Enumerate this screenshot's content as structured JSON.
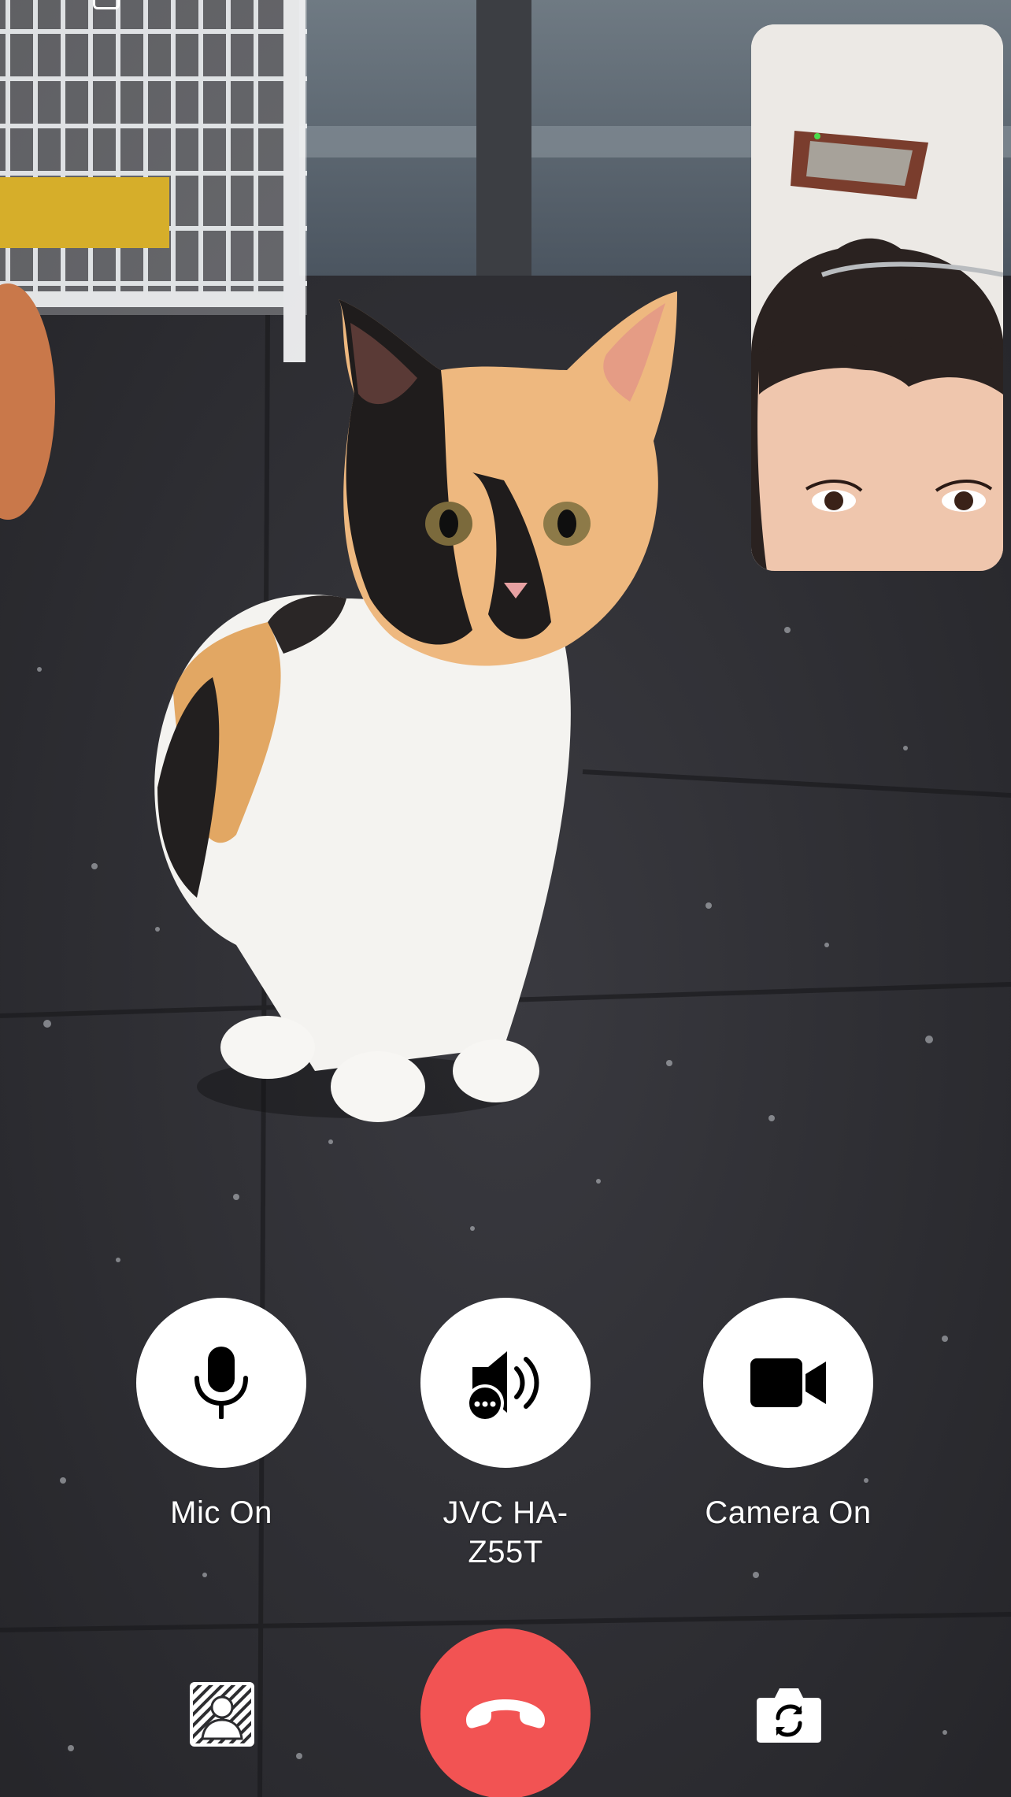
{
  "call": {
    "controls": {
      "mic": {
        "label": "Mic On",
        "icon": "microphone-icon",
        "state": "on"
      },
      "audio": {
        "label": "JVC HA-Z55T",
        "icon": "speaker-with-more-icon"
      },
      "camera": {
        "label": "Camera On",
        "icon": "video-camera-icon",
        "state": "on"
      }
    },
    "bottom": {
      "end_call_icon": "phone-hangup-icon",
      "background_icon": "background-effect-icon",
      "flip_icon": "flip-camera-icon"
    }
  },
  "colors": {
    "end_call": "#f25353",
    "control_bg": "#ffffff",
    "icon": "#000000",
    "label": "#ffffff"
  }
}
